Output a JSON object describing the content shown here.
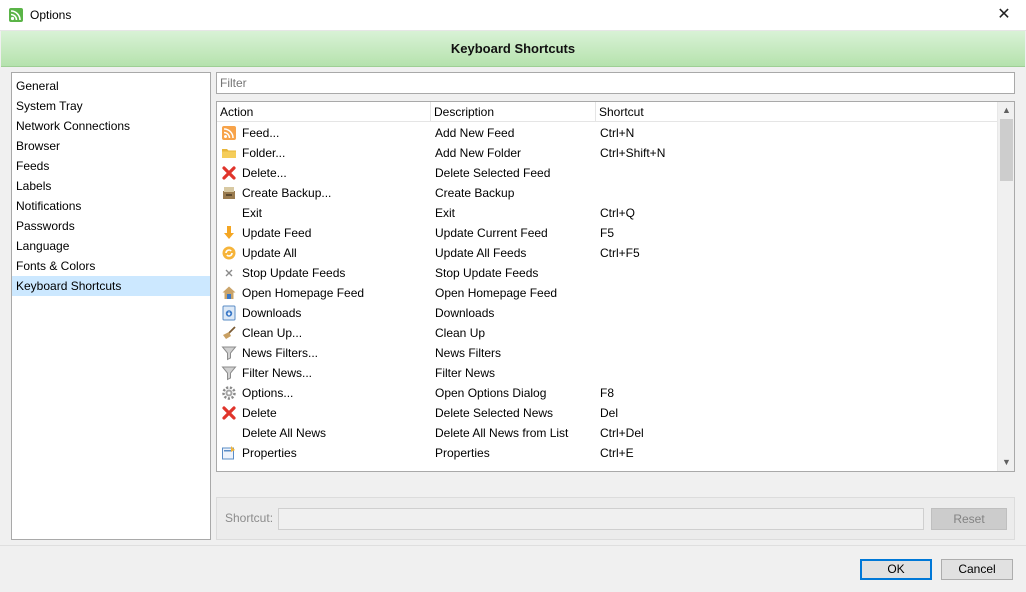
{
  "window": {
    "title": "Options",
    "close_glyph": "✕"
  },
  "header": {
    "title": "Keyboard Shortcuts"
  },
  "categories": [
    {
      "label": "General"
    },
    {
      "label": "System Tray"
    },
    {
      "label": "Network Connections"
    },
    {
      "label": "Browser"
    },
    {
      "label": "Feeds"
    },
    {
      "label": "Labels"
    },
    {
      "label": "Notifications"
    },
    {
      "label": "Passwords"
    },
    {
      "label": "Language"
    },
    {
      "label": "Fonts & Colors"
    },
    {
      "label": "Keyboard Shortcuts",
      "selected": true
    }
  ],
  "filter": {
    "placeholder": "Filter"
  },
  "grid": {
    "columns": {
      "action": "Action",
      "description": "Description",
      "shortcut": "Shortcut"
    },
    "rows": [
      {
        "action": "Feed...",
        "description": "Add New Feed",
        "shortcut": "Ctrl+N",
        "icon": "rss-icon"
      },
      {
        "action": "Folder...",
        "description": "Add New Folder",
        "shortcut": "Ctrl+Shift+N",
        "icon": "folder-icon"
      },
      {
        "action": "Delete...",
        "description": "Delete Selected Feed",
        "shortcut": "",
        "icon": "delete-icon"
      },
      {
        "action": "Create Backup...",
        "description": "Create Backup",
        "shortcut": "",
        "icon": "backup-icon"
      },
      {
        "action": "Exit",
        "description": "Exit",
        "shortcut": "Ctrl+Q",
        "icon": ""
      },
      {
        "action": "Update Feed",
        "description": "Update Current Feed",
        "shortcut": "F5",
        "icon": "update-arrow-icon"
      },
      {
        "action": "Update All",
        "description": "Update All Feeds",
        "shortcut": "Ctrl+F5",
        "icon": "update-all-icon"
      },
      {
        "action": "Stop Update Feeds",
        "description": "Stop Update Feeds",
        "shortcut": "",
        "icon": "stop-icon"
      },
      {
        "action": "Open Homepage Feed",
        "description": "Open Homepage Feed",
        "shortcut": "",
        "icon": "home-icon"
      },
      {
        "action": "Downloads",
        "description": "Downloads",
        "shortcut": "",
        "icon": "downloads-icon"
      },
      {
        "action": "Clean Up...",
        "description": "Clean Up",
        "shortcut": "",
        "icon": "broom-icon"
      },
      {
        "action": "News Filters...",
        "description": "News Filters",
        "shortcut": "",
        "icon": "funnel-icon"
      },
      {
        "action": "Filter News...",
        "description": "Filter News",
        "shortcut": "",
        "icon": "funnel-icon"
      },
      {
        "action": "Options...",
        "description": "Open Options Dialog",
        "shortcut": "F8",
        "icon": "gear-icon"
      },
      {
        "action": "Delete",
        "description": "Delete Selected News",
        "shortcut": "Del",
        "icon": "delete-icon"
      },
      {
        "action": "Delete All News",
        "description": "Delete All News from List",
        "shortcut": "Ctrl+Del",
        "icon": ""
      },
      {
        "action": "Properties",
        "description": "Properties",
        "shortcut": "Ctrl+E",
        "icon": "properties-icon"
      }
    ]
  },
  "editor": {
    "shortcut_label": "Shortcut:",
    "shortcut_value": "",
    "reset_label": "Reset"
  },
  "footer": {
    "ok_label": "OK",
    "cancel_label": "Cancel"
  }
}
